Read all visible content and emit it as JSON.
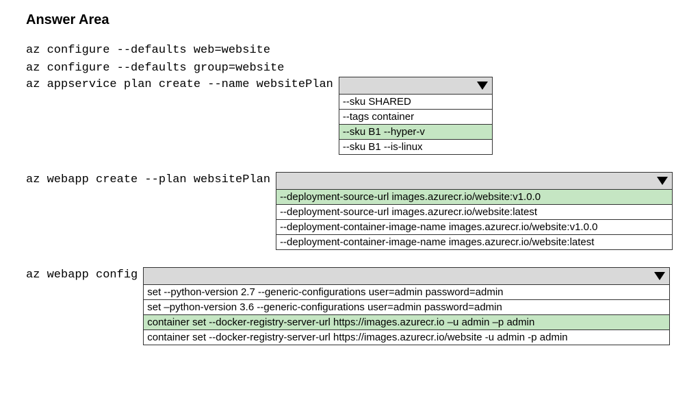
{
  "title": "Answer Area",
  "lines": {
    "l1": "az configure --defaults web=website",
    "l2": "az configure --defaults group=website"
  },
  "cmd1": {
    "prefix": "az appservice plan create --name websitePlan",
    "options": [
      {
        "text": "--sku SHARED",
        "selected": false
      },
      {
        "text": "--tags container",
        "selected": false
      },
      {
        "text": "--sku B1 --hyper-v",
        "selected": true
      },
      {
        "text": "--sku B1 --is-linux",
        "selected": false
      }
    ]
  },
  "cmd2": {
    "prefix": "az webapp create --plan websitePlan",
    "options": [
      {
        "text": "--deployment-source-url images.azurecr.io/website:v1.0.0",
        "selected": true
      },
      {
        "text": "--deployment-source-url images.azurecr.io/website:latest",
        "selected": false
      },
      {
        "text": "--deployment-container-image-name images.azurecr.io/website:v1.0.0",
        "selected": false
      },
      {
        "text": "--deployment-container-image-name images.azurecr.io/website:latest",
        "selected": false
      }
    ]
  },
  "cmd3": {
    "prefix": "az webapp config",
    "options": [
      {
        "text": "set --python-version 2.7 --generic-configurations user=admin password=admin",
        "selected": false
      },
      {
        "text": "set –python-version 3.6 --generic-configurations user=admin password=admin",
        "selected": false
      },
      {
        "text": "container set --docker-registry-server-url https://images.azurecr.io –u admin –p admin",
        "selected": true
      },
      {
        "text": "container set --docker-registry-server-url https://images.azurecr.io/website -u admin -p admin",
        "selected": false
      }
    ]
  }
}
